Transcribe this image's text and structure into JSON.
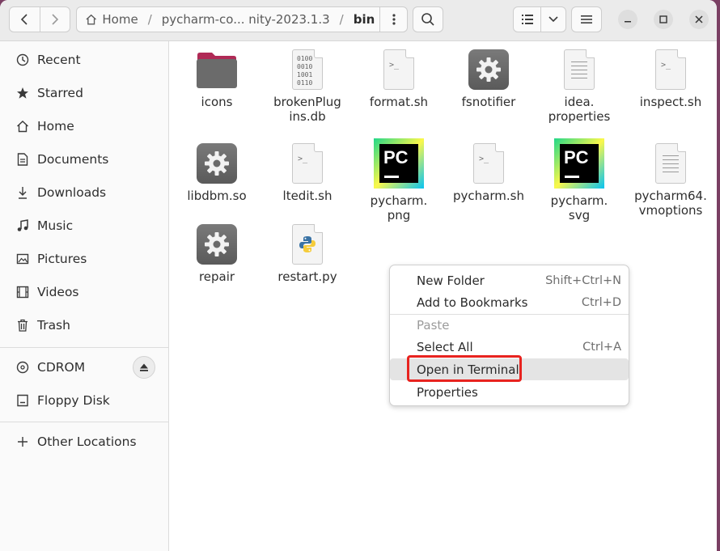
{
  "path": {
    "home": "Home",
    "project": "pycharm-co... nity-2023.1.3",
    "current": "bin"
  },
  "sidebar": {
    "items": [
      {
        "label": "Recent",
        "icon": "clock-icon"
      },
      {
        "label": "Starred",
        "icon": "star-icon"
      },
      {
        "label": "Home",
        "icon": "home-icon"
      },
      {
        "label": "Documents",
        "icon": "document-icon"
      },
      {
        "label": "Downloads",
        "icon": "download-icon"
      },
      {
        "label": "Music",
        "icon": "music-icon"
      },
      {
        "label": "Pictures",
        "icon": "picture-icon"
      },
      {
        "label": "Videos",
        "icon": "video-icon"
      },
      {
        "label": "Trash",
        "icon": "trash-icon"
      }
    ],
    "devices": [
      {
        "label": "CDROM",
        "icon": "disc-icon"
      },
      {
        "label": "Floppy Disk",
        "icon": "drive-icon"
      }
    ],
    "other": {
      "label": "Other Locations",
      "icon": "plus-icon"
    }
  },
  "files": [
    {
      "name": "icons",
      "type": "folder"
    },
    {
      "name": "brokenPlug\nins.db",
      "type": "binary"
    },
    {
      "name": "format.sh",
      "type": "script"
    },
    {
      "name": "fsnotifier",
      "type": "executable"
    },
    {
      "name": "idea.\nproperties",
      "type": "text"
    },
    {
      "name": "inspect.sh",
      "type": "script"
    },
    {
      "name": "libdbm.so",
      "type": "executable"
    },
    {
      "name": "ltedit.sh",
      "type": "script"
    },
    {
      "name": "pycharm.\npng",
      "type": "pycharm"
    },
    {
      "name": "pycharm.sh",
      "type": "script"
    },
    {
      "name": "pycharm.\nsvg",
      "type": "pycharm"
    },
    {
      "name": "pycharm64.\nvmoptions",
      "type": "text"
    },
    {
      "name": "repair",
      "type": "executable"
    },
    {
      "name": "restart.py",
      "type": "python"
    }
  ],
  "context_menu": {
    "items": [
      {
        "label": "New Folder",
        "shortcut": "Shift+Ctrl+N"
      },
      {
        "label": "Add to Bookmarks",
        "shortcut": "Ctrl+D"
      },
      {
        "label": "Paste",
        "shortcut": ""
      },
      {
        "label": "Select All",
        "shortcut": "Ctrl+A"
      },
      {
        "label": "Open in Terminal",
        "shortcut": ""
      },
      {
        "label": "Properties",
        "shortcut": ""
      }
    ]
  },
  "colors": {
    "highlight_box": "#e8231f",
    "folder": "#6b6b6b",
    "folder_tab": "#b02a56"
  }
}
